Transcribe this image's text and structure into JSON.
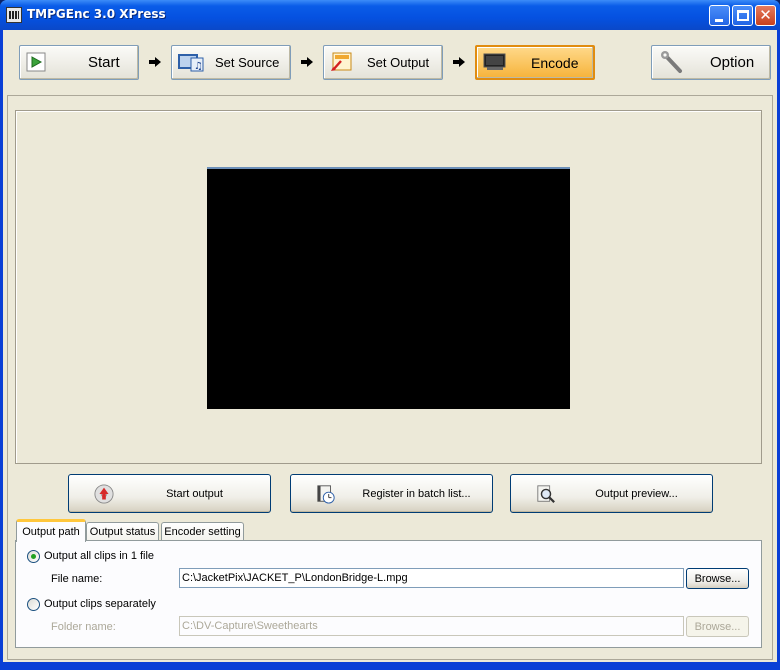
{
  "window": {
    "title": "TMPGEnc 3.0 XPress"
  },
  "toolbar": {
    "start_label": "Start",
    "set_source_label": "Set Source",
    "set_output_label": "Set Output",
    "encode_label": "Encode",
    "option_label": "Option",
    "active_step": "Encode"
  },
  "actions": {
    "start_output": "Start output",
    "register_batch": "Register in batch list...",
    "output_preview": "Output preview..."
  },
  "tabs": [
    {
      "label": "Output path",
      "active": true
    },
    {
      "label": "Output status",
      "active": false
    },
    {
      "label": "Encoder setting",
      "active": false
    }
  ],
  "output_path": {
    "all_clips_label": "Output all clips in 1 file",
    "all_clips_selected": true,
    "file_name_label": "File name:",
    "file_name_value": "C:\\JacketPix\\JACKET_P\\LondonBridge-L.mpg",
    "browse_label": "Browse...",
    "separately_label": "Output clips separately",
    "separately_selected": false,
    "folder_name_label": "Folder name:",
    "folder_name_value": "C:\\DV-Capture\\Sweethearts",
    "folder_browse_label": "Browse..."
  },
  "colors": {
    "titlebar": "#0551e0",
    "window_bg": "#ece9d8",
    "active_step": "#f6b33a",
    "radio_dot": "#21a121"
  }
}
